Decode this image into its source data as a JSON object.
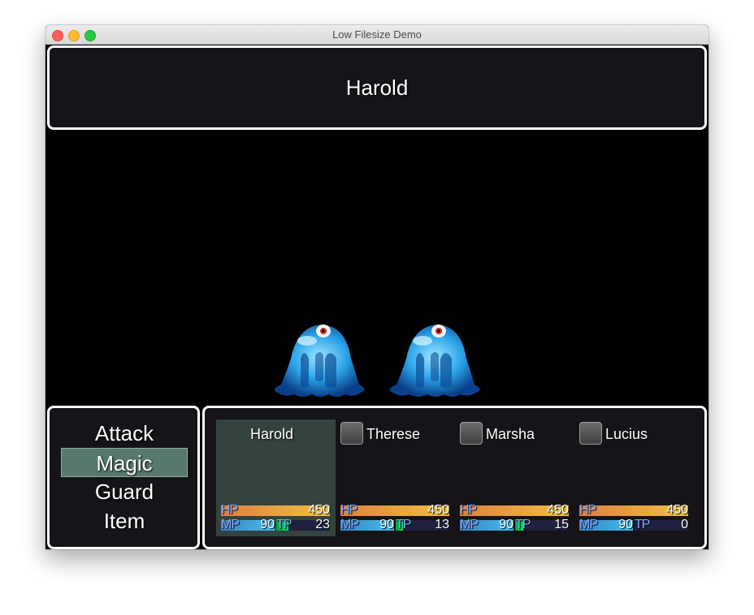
{
  "window": {
    "title": "Low Filesize Demo"
  },
  "help": {
    "text": "Harold"
  },
  "commands": [
    "Attack",
    "Magic",
    "Guard",
    "Item"
  ],
  "selected_command": "Magic",
  "actors": [
    {
      "name": "Harold",
      "hp": "450",
      "mp": "90",
      "tp": "23",
      "hp_ratio": 1.0,
      "mp_ratio": 1.0,
      "tp_ratio": 0.23,
      "active": true
    },
    {
      "name": "Therese",
      "hp": "450",
      "mp": "90",
      "tp": "13",
      "hp_ratio": 1.0,
      "mp_ratio": 1.0,
      "tp_ratio": 0.13,
      "active": false
    },
    {
      "name": "Marsha",
      "hp": "450",
      "mp": "90",
      "tp": "15",
      "hp_ratio": 1.0,
      "mp_ratio": 1.0,
      "tp_ratio": 0.15,
      "active": false
    },
    {
      "name": "Lucius",
      "hp": "450",
      "mp": "90",
      "tp": "0",
      "hp_ratio": 1.0,
      "mp_ratio": 1.0,
      "tp_ratio": 0.0,
      "active": false
    }
  ],
  "labels": {
    "hp": "HP",
    "mp": "MP",
    "tp": "TP"
  },
  "enemies": [
    "slime",
    "slime"
  ],
  "colors": {
    "panel_bg": "#161418",
    "selection": "#56796c",
    "active_actor": "#34433f",
    "label": "#84a9ff"
  }
}
